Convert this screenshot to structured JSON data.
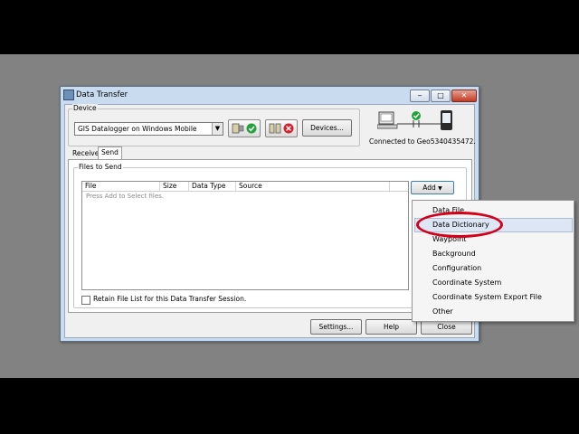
{
  "window": {
    "title": "Data Transfer",
    "controls": [
      "‒",
      "□",
      "✕"
    ]
  },
  "device": {
    "legend": "Device",
    "selected": "GIS Datalogger on Windows Mobile",
    "devices_button": "Devices...",
    "status": "Connected to Geo5340435472."
  },
  "tabs": [
    {
      "label": "Receive",
      "active": false
    },
    {
      "label": "Send",
      "active": true
    }
  ],
  "files": {
    "legend": "Files to Send",
    "columns": [
      "File",
      "Size",
      "Data Type",
      "Source"
    ],
    "placeholder": "Press Add to Select files.",
    "add_button": "Add",
    "retain_label": "Retain File List for this Data Transfer Session.",
    "retain_checked": false
  },
  "footer": {
    "settings": "Settings...",
    "help": "Help",
    "close": "Close"
  },
  "add_menu": {
    "items": [
      "Data File",
      "Data Dictionary",
      "Waypoint",
      "Background",
      "Configuration",
      "Coordinate System",
      "Coordinate System Export File",
      "Other"
    ],
    "highlighted": "Data Dictionary"
  },
  "colors": {
    "connected": "#22a33a",
    "error": "#d3212d",
    "highlight_ring": "#d4001a",
    "titlebar": "#c9dcef"
  }
}
